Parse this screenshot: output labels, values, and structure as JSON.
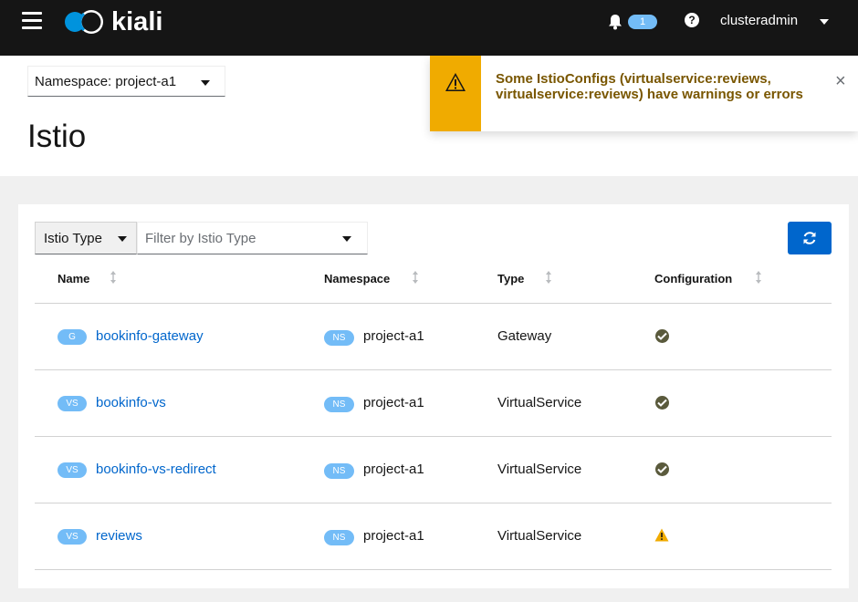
{
  "app": {
    "name": "kiali",
    "notification_count": "1",
    "help_label": "?",
    "user": "clusteradmin"
  },
  "namespace_selector": {
    "label": "Namespace: project-a1"
  },
  "page": {
    "title": "Istio"
  },
  "alert": {
    "text": "Some IstioConfigs (virtualservice:reviews, virtualservice:reviews) have warnings or errors",
    "close": "×",
    "color": "#f0ab00"
  },
  "filter": {
    "type_label": "Istio Type",
    "placeholder": "Filter by Istio Type"
  },
  "table": {
    "headers": [
      "Name",
      "Namespace",
      "Type",
      "Configuration"
    ],
    "rows": [
      {
        "badge": "G",
        "name": "bookinfo-gateway",
        "ns_badge": "NS",
        "namespace": "project-a1",
        "type": "Gateway",
        "config": "valid"
      },
      {
        "badge": "VS",
        "name": "bookinfo-vs",
        "ns_badge": "NS",
        "namespace": "project-a1",
        "type": "VirtualService",
        "config": "valid"
      },
      {
        "badge": "VS",
        "name": "bookinfo-vs-redirect",
        "ns_badge": "NS",
        "namespace": "project-a1",
        "type": "VirtualService",
        "config": "valid"
      },
      {
        "badge": "VS",
        "name": "reviews",
        "ns_badge": "NS",
        "namespace": "project-a1",
        "type": "VirtualService",
        "config": "warning"
      }
    ]
  },
  "colors": {
    "masthead": "#151515",
    "link": "#0066cc",
    "badge": "#73bcf7",
    "primary_button": "#0066cc",
    "warning": "#f0ab00"
  }
}
